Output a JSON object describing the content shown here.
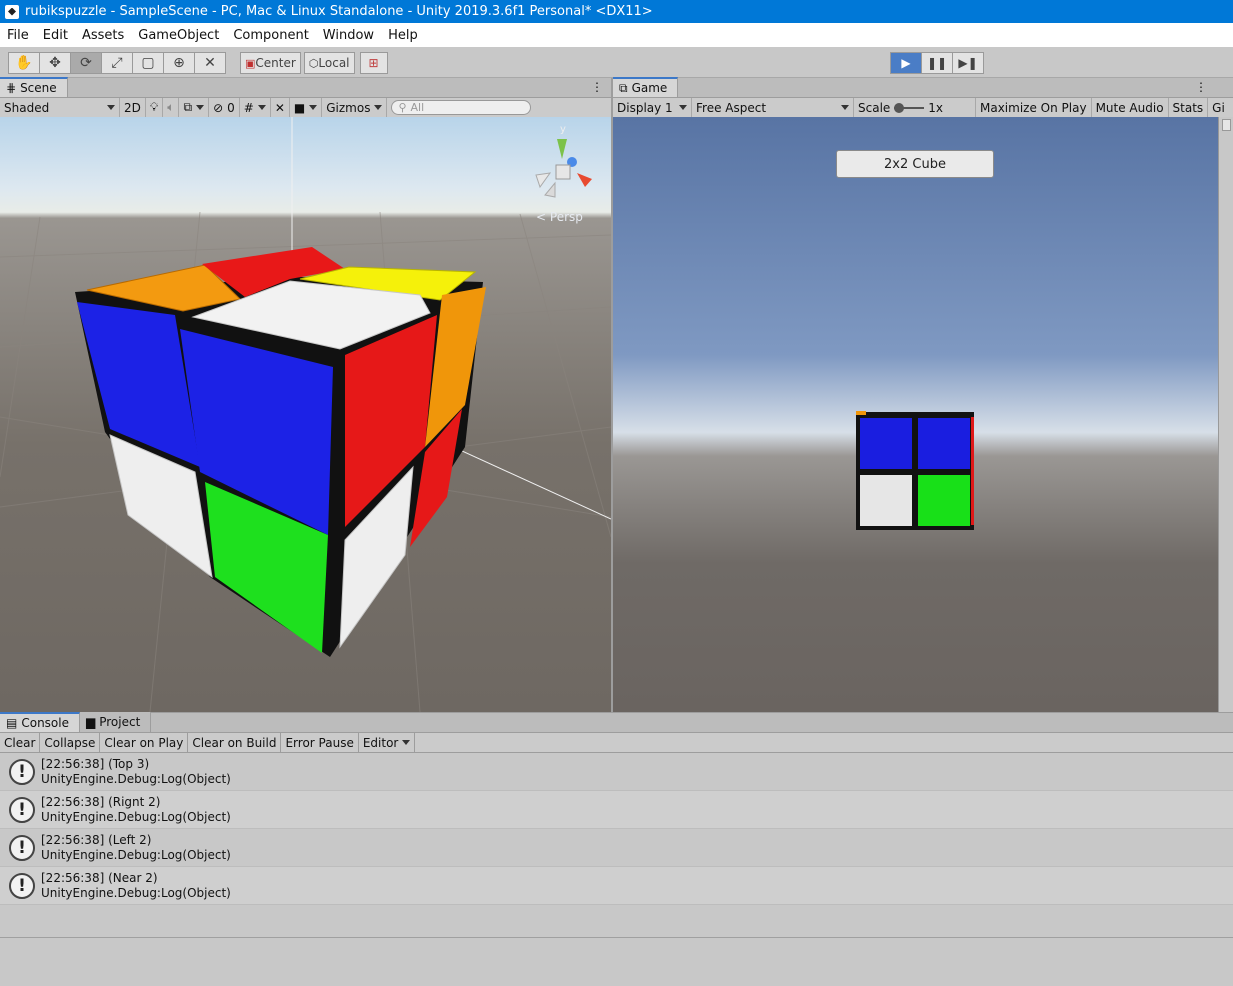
{
  "window": {
    "title": "rubikspuzzle - SampleScene - PC, Mac & Linux Standalone - Unity 2019.3.6f1 Personal* <DX11>"
  },
  "menu": [
    "File",
    "Edit",
    "Assets",
    "GameObject",
    "Component",
    "Window",
    "Help"
  ],
  "toolbar": {
    "pivot_label": "Center",
    "space_label": "Local"
  },
  "scene": {
    "tab_label": "Scene",
    "shading_mode": "Shaded",
    "mode_2d": "2D",
    "hidden_count": "0",
    "gizmos_label": "Gizmos",
    "search_placeholder": "All",
    "projection_label": "Persp",
    "gizmo_axis": "y"
  },
  "game": {
    "tab_label": "Game",
    "display": "Display 1",
    "aspect": "Free Aspect",
    "scale_label": "Scale",
    "scale_value": "1x",
    "maximize_label": "Maximize On Play",
    "mute_label": "Mute Audio",
    "stats_label": "Stats",
    "gizmos_short": "Gi",
    "button_label": "2x2 Cube"
  },
  "console": {
    "tab_console": "Console",
    "tab_project": "Project",
    "buttons": [
      "Clear",
      "Collapse",
      "Clear on Play",
      "Clear on Build",
      "Error Pause",
      "Editor"
    ],
    "logs": [
      {
        "line1": "[22:56:38] (Top 3)",
        "line2": "UnityEngine.Debug:Log(Object)"
      },
      {
        "line1": "[22:56:38] (Rignt 2)",
        "line2": "UnityEngine.Debug:Log(Object)"
      },
      {
        "line1": "[22:56:38] (Left 2)",
        "line2": "UnityEngine.Debug:Log(Object)"
      },
      {
        "line1": "[22:56:38] (Near 2)",
        "line2": "UnityEngine.Debug:Log(Object)"
      }
    ]
  },
  "colors": {
    "title_bar": "#0078d7",
    "play_active": "#4a7dc6",
    "cube_blue": "#1a1ee0",
    "cube_red": "#e01818",
    "cube_green": "#18e018",
    "cube_white": "#ececec",
    "cube_orange": "#f0960a",
    "cube_yellow": "#f2f20a"
  }
}
